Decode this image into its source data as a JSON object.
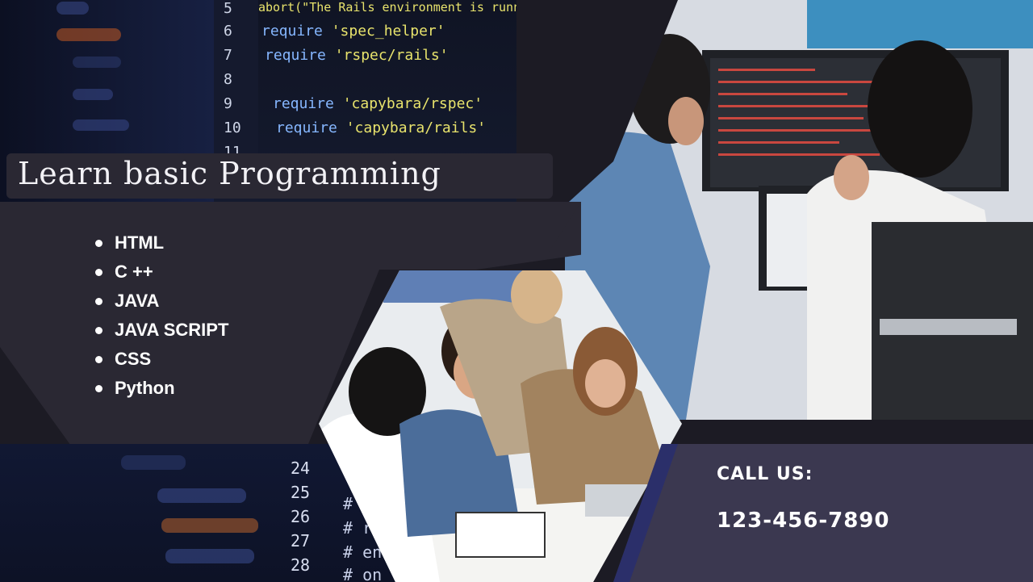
{
  "title": "Learn basic Programming",
  "courses": [
    "HTML",
    "C ++",
    "JAVA",
    "JAVA SCRIPT",
    "CSS",
    "Python"
  ],
  "contact": {
    "label": "CALL US:",
    "phone": "123-456-7890"
  },
  "code_top": {
    "line_numbers": [
      "5",
      "6",
      "7",
      "8",
      "9",
      "10",
      "11"
    ],
    "line_abort": "abort(\"The Rails environment is running in production mode!\") if Rails",
    "line_require_1_kw": "require",
    "line_require_1_str": "'spec_helper'",
    "line_require_2_kw": "require",
    "line_require_2_str": "'rspec/rails'",
    "line_require_3_kw": "require",
    "line_require_3_str": "'capybara/rspec'",
    "line_require_4_kw": "require",
    "line_require_4_str": "'capybara/rails'"
  },
  "code_bottom": {
    "line_numbers": [
      "24",
      "25",
      "26",
      "27",
      "28"
    ],
    "lines": [
      "# in",
      "# run",
      "# end",
      "# on"
    ]
  },
  "colors": {
    "background": "#1c1b24",
    "panel": "#2a2833",
    "call_panel": "#3b3850",
    "text": "#ffffff",
    "accent_blue": "#2b2f6a"
  },
  "icons": {
    "bullet": "disc-bullet-icon"
  }
}
